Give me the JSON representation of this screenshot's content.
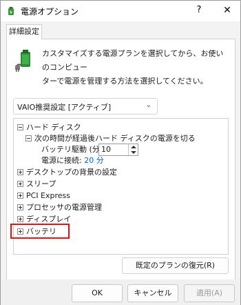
{
  "window": {
    "title": "電源オプション",
    "help": "?",
    "close": "✕"
  },
  "tab": {
    "label": "詳細設定"
  },
  "intro": {
    "line1": "カスタマイズする電源プランを選択してから、お使いのコンピュー",
    "line2": "ターで電源を管理する方法を選択してください。"
  },
  "plan_select": {
    "value": "VAIO推奨設定 [アクティブ]"
  },
  "tree": {
    "hard_disk": "ハード ディスク",
    "turn_off_after": "次の時間が経過後ハード ディスクの電源を切る",
    "battery_label": "バッテリ駆動 (分):",
    "battery_value": "10",
    "plugged_label": "電源に接続:",
    "plugged_value": "20 分",
    "items": [
      "デスクトップの背景の設定",
      "スリープ",
      "PCI Express",
      "プロセッサの電源管理",
      "ディスプレイ",
      "バッテリ"
    ]
  },
  "buttons": {
    "restore": "既定のプランの復元(R)",
    "ok": "OK",
    "cancel": "キャンセル",
    "apply": "適用(A)"
  },
  "colors": {
    "link": "#0066cc",
    "highlight": "#e01010"
  }
}
